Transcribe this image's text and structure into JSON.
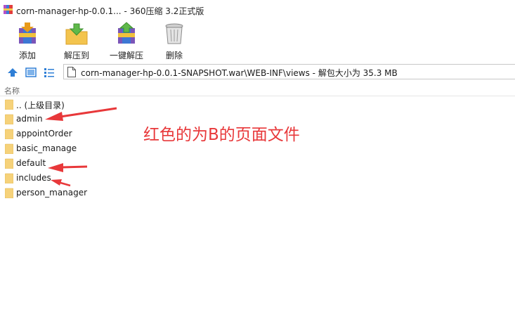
{
  "window": {
    "title": "corn-manager-hp-0.0.1... - 360压缩 3.2正式版",
    "app_icon": "winrar-books-icon"
  },
  "toolbar": {
    "buttons": [
      {
        "label": "添加",
        "icon": "add-archive-icon"
      },
      {
        "label": "解压到",
        "icon": "extract-to-icon"
      },
      {
        "label": "一键解压",
        "icon": "one-click-extract-icon"
      },
      {
        "label": "删除",
        "icon": "trash-icon"
      }
    ]
  },
  "address_bar": {
    "icons": [
      "up-arrow-icon",
      "thumbnail-view-icon",
      "list-view-icon",
      "file-icon"
    ],
    "path": "corn-manager-hp-0.0.1-SNAPSHOT.war\\WEB-INF\\views - 解包大小为 35.3 MB"
  },
  "file_list": {
    "column_header": "名称",
    "items": [
      {
        "name": ".. (上级目录)",
        "icon": "folder-icon"
      },
      {
        "name": "admin",
        "icon": "folder-icon"
      },
      {
        "name": "appointOrder",
        "icon": "folder-icon"
      },
      {
        "name": "basic_manage",
        "icon": "folder-icon"
      },
      {
        "name": "default",
        "icon": "folder-icon"
      },
      {
        "name": "includes",
        "icon": "folder-icon"
      },
      {
        "name": "person_manager",
        "icon": "folder-icon"
      }
    ]
  },
  "annotation": {
    "text": "红色的为B的页面文件",
    "color": "#e8383a"
  },
  "colors": {
    "folder_fill": "#f6d27a",
    "arrow": "#e8383a",
    "nav_blue": "#2f7fd6"
  }
}
